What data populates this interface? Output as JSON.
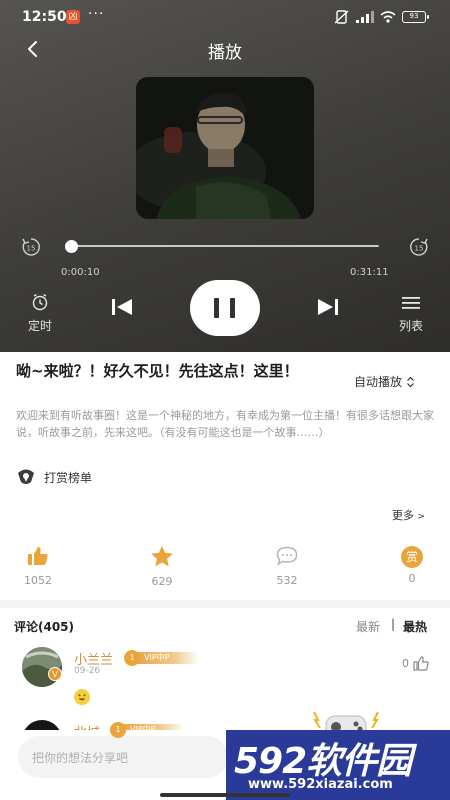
{
  "status_bar": {
    "time": "12:50",
    "app_badge": "凶",
    "more": "···",
    "battery": "93"
  },
  "header": {
    "title": "播放"
  },
  "player": {
    "progress": 0.005,
    "current_time": "0:00:10",
    "total_time": "0:31:11",
    "seek_back_label": "15",
    "seek_forward_label": "15",
    "timer_label": "定时",
    "list_label": "列表"
  },
  "episode": {
    "title": "呦~来啦？！好久不见！先往这点！这里！",
    "autoplay_label": "自动播放",
    "description": "欢迎来到有听故事圈！这是一个神秘的地方，有幸成为第一位主播！有很多话想跟大家说，听故事之前，先来这吧。（有没有可能这也是一个故事……）",
    "reward_label": "打赏榜单",
    "more_label": "更多"
  },
  "actions": {
    "like_count": "1052",
    "favorite_count": "629",
    "comment_count": "532",
    "tip_char": "赏",
    "tip_count": "0"
  },
  "comments": {
    "header": "评论(405)",
    "sort_latest": "最新",
    "sort_sep": "|",
    "sort_hot": "最热",
    "items": [
      {
        "name": "小兰兰",
        "level": "1",
        "vip": "VIP中P",
        "date": "09-26",
        "likes": "0",
        "badge": "V"
      },
      {
        "name": "北城",
        "level": "1",
        "vip": "VIP中P"
      }
    ]
  },
  "input": {
    "placeholder": "把你的想法分享吧"
  },
  "watermark": {
    "brand": "592软件园",
    "url": "www.592xiazai.com"
  },
  "colors": {
    "accent_gold": "#e9a53b",
    "player_bg": "#4a4946",
    "watermark_bg": "#2a3a99"
  }
}
